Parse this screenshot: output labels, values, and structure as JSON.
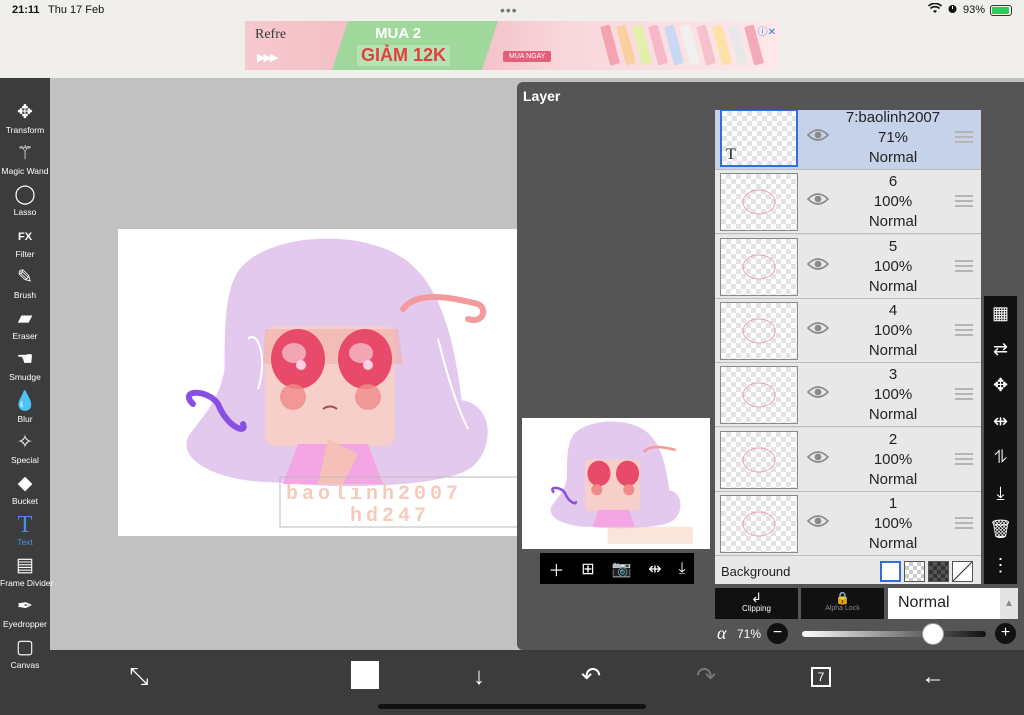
{
  "status": {
    "time": "21:11",
    "date": "Thu 17 Feb",
    "battery": "93%"
  },
  "ad": {
    "brand": "Refre",
    "headline": "MUA 2",
    "discount": "GIẢM 12K",
    "cta": "MUA NGAY",
    "info_icon": "ⓘ✕"
  },
  "tools": [
    {
      "name": "transform",
      "label": "Transform",
      "icon": "✥"
    },
    {
      "name": "magic-wand",
      "label": "Magic Wand",
      "icon": "⚚"
    },
    {
      "name": "lasso",
      "label": "Lasso",
      "icon": "◯"
    },
    {
      "name": "filter",
      "label": "Filter",
      "icon": "FX"
    },
    {
      "name": "brush",
      "label": "Brush",
      "icon": "✎"
    },
    {
      "name": "eraser",
      "label": "Eraser",
      "icon": "▰"
    },
    {
      "name": "smudge",
      "label": "Smudge",
      "icon": "☚"
    },
    {
      "name": "blur",
      "label": "Blur",
      "icon": "💧"
    },
    {
      "name": "special",
      "label": "Special",
      "icon": "✧"
    },
    {
      "name": "bucket",
      "label": "Bucket",
      "icon": "◆"
    },
    {
      "name": "text",
      "label": "Text",
      "icon": "T"
    },
    {
      "name": "frame-divider",
      "label": "Frame Divider",
      "icon": "▤"
    },
    {
      "name": "eyedropper",
      "label": "Eyedropper",
      "icon": "✒"
    },
    {
      "name": "canvas",
      "label": "Canvas",
      "icon": "▢"
    }
  ],
  "active_tool": "Text",
  "artwork": {
    "watermark_line1": "baolinh2007",
    "watermark_line2": "hd247"
  },
  "layer_panel": {
    "title": "Layer",
    "layers": [
      {
        "name": "7:baolinh2007",
        "opacity": "71%",
        "blend": "Normal",
        "selected": true,
        "text_layer": true
      },
      {
        "name": "6",
        "opacity": "100%",
        "blend": "Normal",
        "selected": false
      },
      {
        "name": "5",
        "opacity": "100%",
        "blend": "Normal",
        "selected": false
      },
      {
        "name": "4",
        "opacity": "100%",
        "blend": "Normal",
        "selected": false
      },
      {
        "name": "3",
        "opacity": "100%",
        "blend": "Normal",
        "selected": false
      },
      {
        "name": "2",
        "opacity": "100%",
        "blend": "Normal",
        "selected": false
      },
      {
        "name": "1",
        "opacity": "100%",
        "blend": "Normal",
        "selected": false
      }
    ],
    "text_layer_glyph": "T",
    "background_label": "Background",
    "clipping_label": "Clipping",
    "alpha_lock_label": "Alpha Lock",
    "blend_mode": "Normal",
    "alpha_symbol": "α",
    "opacity_label": "71%",
    "opacity_value": 0.71
  },
  "bottom": {
    "layer_count": "7"
  },
  "colors": {
    "accent": "#2f6fd6",
    "toolbar": "#3c3c3c",
    "panel": "#555555",
    "selected_row": "#c6d1ea"
  }
}
